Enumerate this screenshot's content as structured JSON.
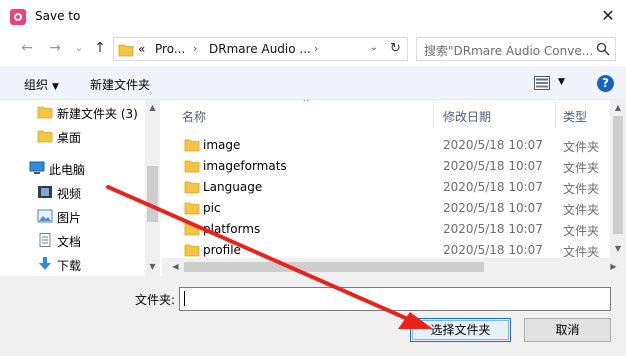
{
  "window": {
    "title": "Save to",
    "close_glyph": "✕"
  },
  "nav": {
    "back_glyph": "←",
    "forward_glyph": "→",
    "dropdown_glyph": "⌄",
    "up_glyph": "↑",
    "breadcrumb_prefix": "«",
    "breadcrumbs": [
      "Pro...",
      "DRmare Audio ..."
    ],
    "crumb_sep": "›",
    "addr_dropdown_glyph": "⌄",
    "refresh_glyph": "↻",
    "search_placeholder": "搜索\"DRmare Audio Conve..."
  },
  "toolbar": {
    "organize_label": "组织",
    "organize_dd": "▼",
    "new_folder_label": "新建文件夹",
    "view_dd": "▼",
    "help_glyph": "?"
  },
  "sidebar": {
    "items": [
      {
        "label": "新建文件夹 (3)",
        "icon": "folder-icon"
      },
      {
        "label": "桌面",
        "icon": "folder-icon"
      },
      {
        "label": "此电脑",
        "icon": "computer-icon"
      },
      {
        "label": "视频",
        "icon": "video-icon"
      },
      {
        "label": "图片",
        "icon": "picture-icon"
      },
      {
        "label": "文档",
        "icon": "document-icon"
      },
      {
        "label": "下载",
        "icon": "download-icon"
      }
    ]
  },
  "file_list": {
    "sort_glyph": "^",
    "headers": {
      "name": "名称",
      "date": "修改日期",
      "type": "类型"
    },
    "rows": [
      {
        "name": "image",
        "date": "2020/5/18 10:07",
        "type": "文件夹"
      },
      {
        "name": "imageformats",
        "date": "2020/5/18 10:07",
        "type": "文件夹"
      },
      {
        "name": "Language",
        "date": "2020/5/18 10:07",
        "type": "文件夹"
      },
      {
        "name": "pic",
        "date": "2020/5/18 10:07",
        "type": "文件夹"
      },
      {
        "name": "platforms",
        "date": "2020/5/18 10:07",
        "type": "文件夹"
      },
      {
        "name": "profile",
        "date": "2020/5/18 10:07",
        "type": "文件夹"
      }
    ]
  },
  "scroll": {
    "up": "▲",
    "down": "▼",
    "left": "◀",
    "right": "▶"
  },
  "footer": {
    "folder_label": "文件夹:",
    "folder_value": "",
    "select_button": "选择文件夹",
    "cancel_button": "取消"
  },
  "colors": {
    "folder": "#f4c542",
    "accent": "#0078d7",
    "annotation_arrow": "#e8241a"
  }
}
